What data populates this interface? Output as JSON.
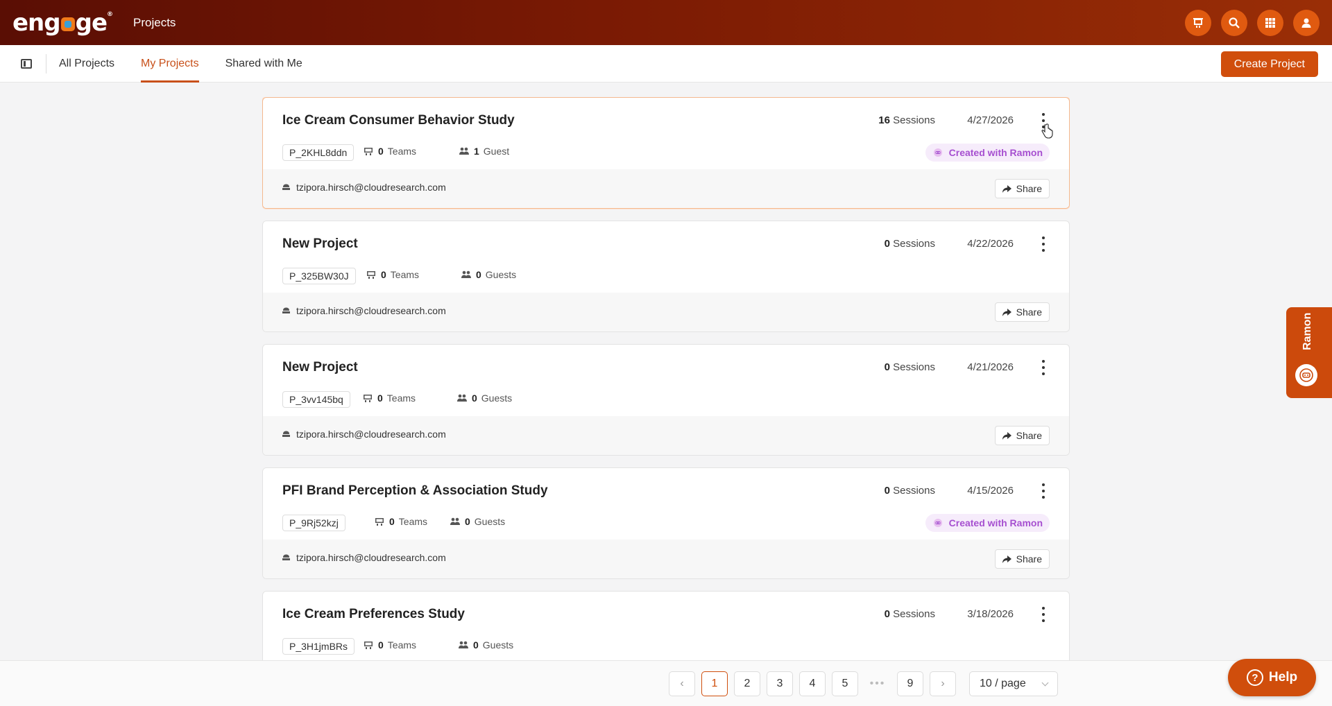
{
  "app": {
    "logo": "engage",
    "title": "Projects"
  },
  "header_icons": [
    "presentation-icon",
    "search-icon",
    "apps-grid-icon",
    "user-icon"
  ],
  "tabs": [
    {
      "label": "All Projects",
      "active": false
    },
    {
      "label": "My Projects",
      "active": true
    },
    {
      "label": "Shared with Me",
      "active": false
    }
  ],
  "create_button": "Create Project",
  "projects": [
    {
      "title": "Ice Cream Consumer Behavior Study",
      "sessions_count": "16",
      "sessions_label": "Sessions",
      "date": "4/27/2026",
      "id": "P_2KHL8ddn",
      "teams_count": "0",
      "teams_label": "Teams",
      "guests_count": "1",
      "guests_label": "Guest",
      "ramon": "Created with Ramon",
      "email": "tzipora.hirsch@cloudresearch.com",
      "share": "Share"
    },
    {
      "title": "New Project",
      "sessions_count": "0",
      "sessions_label": "Sessions",
      "date": "4/22/2026",
      "id": "P_325BW30J",
      "teams_count": "0",
      "teams_label": "Teams",
      "guests_count": "0",
      "guests_label": "Guests",
      "ramon": "",
      "email": "tzipora.hirsch@cloudresearch.com",
      "share": "Share"
    },
    {
      "title": "New Project",
      "sessions_count": "0",
      "sessions_label": "Sessions",
      "date": "4/21/2026",
      "id": "P_3vv145bq",
      "teams_count": "0",
      "teams_label": "Teams",
      "guests_count": "0",
      "guests_label": "Guests",
      "ramon": "",
      "email": "tzipora.hirsch@cloudresearch.com",
      "share": "Share"
    },
    {
      "title": "PFI Brand Perception & Association Study",
      "sessions_count": "0",
      "sessions_label": "Sessions",
      "date": "4/15/2026",
      "id": "P_9Rj52kzj",
      "teams_count": "0",
      "teams_label": "Teams",
      "guests_count": "0",
      "guests_label": "Guests",
      "ramon": "Created with Ramon",
      "email": "tzipora.hirsch@cloudresearch.com",
      "share": "Share"
    },
    {
      "title": "Ice Cream Preferences Study",
      "sessions_count": "0",
      "sessions_label": "Sessions",
      "date": "3/18/2026",
      "id": "P_3H1jmBRs",
      "teams_count": "0",
      "teams_label": "Teams",
      "guests_count": "0",
      "guests_label": "Guests",
      "ramon": "",
      "email": "",
      "share": ""
    }
  ],
  "pagination": {
    "pages": [
      "1",
      "2",
      "3",
      "4",
      "5",
      "9"
    ],
    "current": "1",
    "ellipsis": "•••",
    "page_size": "10 / page"
  },
  "ramon_tab": "Ramon",
  "help": "Help",
  "colors": {
    "accent": "#d04e0c",
    "header_dark": "#5a0e04",
    "ramon_purple": "#a64fd0"
  }
}
